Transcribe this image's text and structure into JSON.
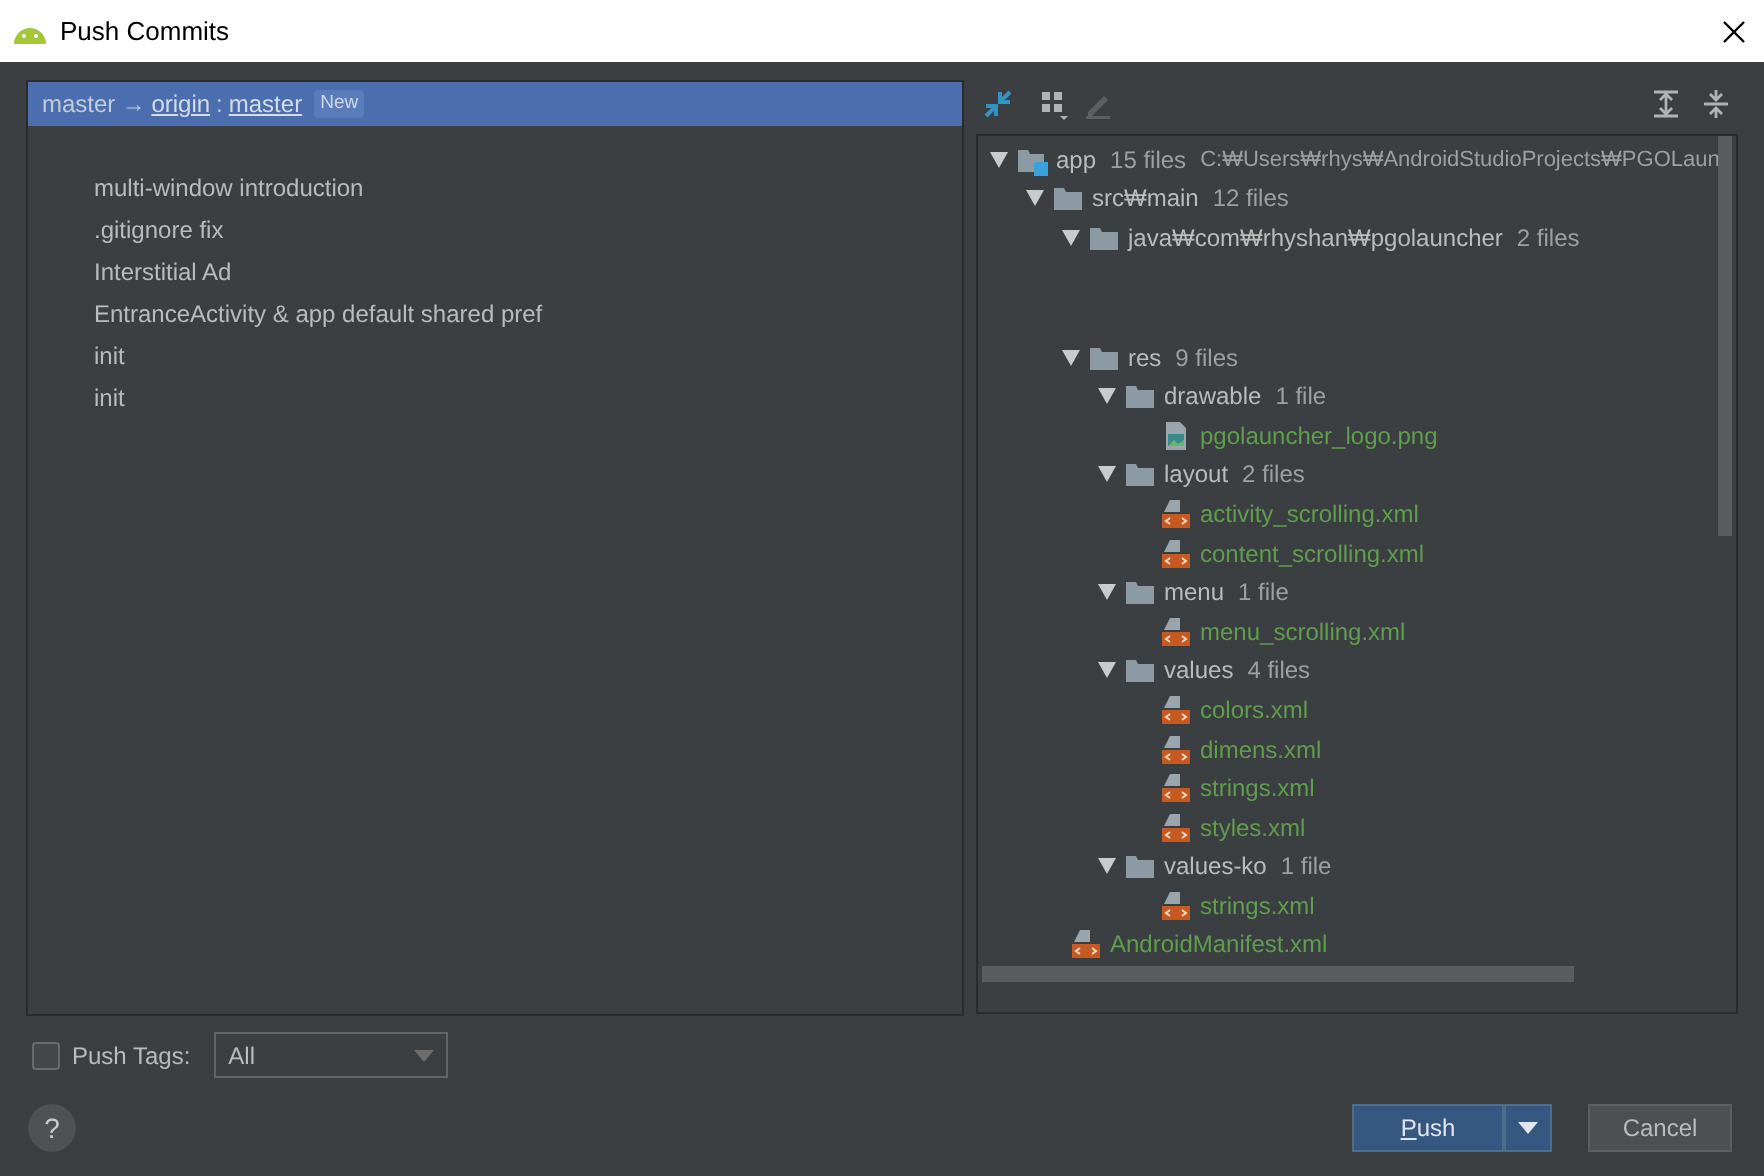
{
  "window": {
    "title": "Push Commits"
  },
  "branch": {
    "local": "master",
    "arrow": "→",
    "remote": "origin",
    "separator": ":",
    "remote_branch": "master",
    "badge": "New",
    "selected": true
  },
  "commits": [
    "multi-window introduction",
    ".gitignore fix",
    "Interstitial Ad",
    "EntranceActivity & app default shared pref",
    "init",
    "init"
  ],
  "tree": [
    {
      "kind": "module",
      "label": "app",
      "count": "15 files",
      "path": "C:₩Users₩rhys₩AndroidStudioProjects₩PGOLaun",
      "expanded": true,
      "children": [
        {
          "kind": "folder",
          "label": "src₩main",
          "count": "12 files",
          "expanded": true,
          "children": [
            {
              "kind": "folder",
              "label": "java₩com₩rhyshan₩pgolauncher",
              "count": "2 files",
              "expanded": true
            },
            {
              "kind": "folder",
              "label": "res",
              "count": "9 files",
              "expanded": true,
              "children": [
                {
                  "kind": "folder",
                  "label": "drawable",
                  "count": "1 file",
                  "expanded": true,
                  "children": [
                    {
                      "kind": "image",
                      "label": "pgolauncher_logo.png"
                    }
                  ]
                },
                {
                  "kind": "folder",
                  "label": "layout",
                  "count": "2 files",
                  "expanded": true,
                  "children": [
                    {
                      "kind": "xml",
                      "label": "activity_scrolling.xml"
                    },
                    {
                      "kind": "xml",
                      "label": "content_scrolling.xml"
                    }
                  ]
                },
                {
                  "kind": "folder",
                  "label": "menu",
                  "count": "1 file",
                  "expanded": true,
                  "children": [
                    {
                      "kind": "xml",
                      "label": "menu_scrolling.xml"
                    }
                  ]
                },
                {
                  "kind": "folder",
                  "label": "values",
                  "count": "4 files",
                  "expanded": true,
                  "children": [
                    {
                      "kind": "xml",
                      "label": "colors.xml"
                    },
                    {
                      "kind": "xml",
                      "label": "dimens.xml"
                    },
                    {
                      "kind": "xml",
                      "label": "strings.xml"
                    },
                    {
                      "kind": "xml",
                      "label": "styles.xml"
                    }
                  ]
                },
                {
                  "kind": "folder",
                  "label": "values-ko",
                  "count": "1 file",
                  "expanded": true,
                  "children": [
                    {
                      "kind": "xml",
                      "label": "strings.xml"
                    }
                  ]
                }
              ]
            },
            {
              "kind": "xml",
              "label": "AndroidManifest.xml"
            }
          ]
        }
      ]
    }
  ],
  "push_tags": {
    "label": "Push Tags:",
    "checked": false,
    "value": "All"
  },
  "help": "?",
  "buttons": {
    "push": "Push",
    "cancel": "Cancel"
  }
}
